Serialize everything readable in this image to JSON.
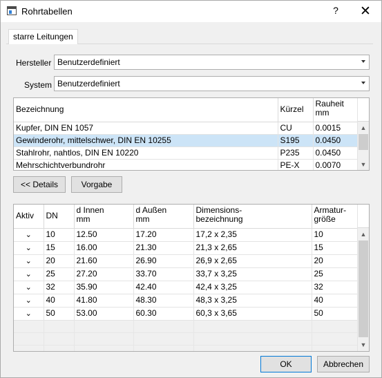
{
  "window": {
    "title": "Rohrtabellen",
    "help": "?",
    "close": "✕"
  },
  "tabs": [
    {
      "label": "starre Leitungen",
      "active": true
    }
  ],
  "form": {
    "hersteller_label": "Hersteller",
    "hersteller_value": "Benutzerdefiniert",
    "system_label": "System",
    "system_value": "Benutzerdefiniert"
  },
  "materials": {
    "columns": [
      "Bezeichnung",
      "Kürzel",
      "Rauheit\nmm"
    ],
    "rows": [
      {
        "name": "Kupfer, DIN EN 1057",
        "code": "CU",
        "roughness": "0.0015",
        "selected": false
      },
      {
        "name": "Gewinderohr, mittelschwer, DIN EN 10255",
        "code": "S195",
        "roughness": "0.0450",
        "selected": true
      },
      {
        "name": "Stahlrohr, nahtlos, DIN EN 10220",
        "code": "P235",
        "roughness": "0.0450",
        "selected": false
      },
      {
        "name": "Mehrschichtverbundrohr",
        "code": "PE-X",
        "roughness": "0.0070",
        "selected": false
      }
    ]
  },
  "buttons": {
    "details": "<< Details",
    "vorgabe": "Vorgabe",
    "ok": "OK",
    "abbrechen": "Abbrechen"
  },
  "sizes": {
    "columns": [
      "Aktiv",
      "DN",
      "d Innen\nmm",
      "d Außen\nmm",
      "Dimensions-\nbezeichnung",
      "Armatur-\ngröße"
    ],
    "check_symbol": "⌄",
    "rows": [
      {
        "active": true,
        "dn": "10",
        "d_inner": "12.50",
        "d_outer": "17.20",
        "designation": "17,2 x 2,35",
        "fitting": "10"
      },
      {
        "active": true,
        "dn": "15",
        "d_inner": "16.00",
        "d_outer": "21.30",
        "designation": "21,3 x 2,65",
        "fitting": "15"
      },
      {
        "active": true,
        "dn": "20",
        "d_inner": "21.60",
        "d_outer": "26.90",
        "designation": "26,9 x 2,65",
        "fitting": "20"
      },
      {
        "active": true,
        "dn": "25",
        "d_inner": "27.20",
        "d_outer": "33.70",
        "designation": "33,7 x 3,25",
        "fitting": "25"
      },
      {
        "active": true,
        "dn": "32",
        "d_inner": "35.90",
        "d_outer": "42.40",
        "designation": "42,4 x 3,25",
        "fitting": "32"
      },
      {
        "active": true,
        "dn": "40",
        "d_inner": "41.80",
        "d_outer": "48.30",
        "designation": "48,3 x 3,25",
        "fitting": "40"
      },
      {
        "active": true,
        "dn": "50",
        "d_inner": "53.00",
        "d_outer": "60.30",
        "designation": "60,3 x 3,65",
        "fitting": "50"
      }
    ]
  },
  "colors": {
    "selection": "#cce4f7",
    "accent": "#0078d7"
  }
}
